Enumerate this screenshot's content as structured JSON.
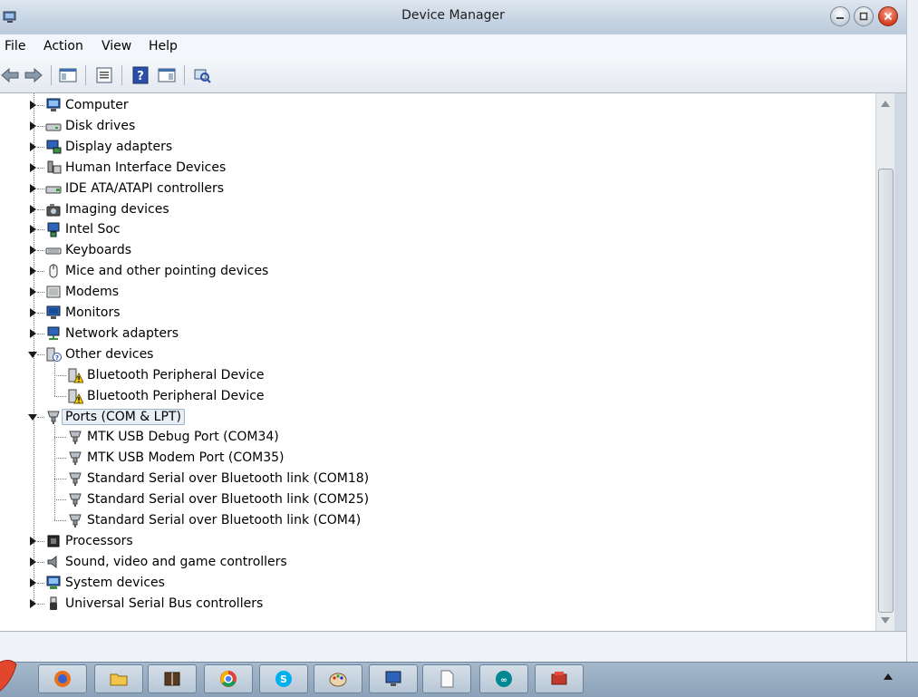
{
  "window": {
    "title": "Device Manager"
  },
  "menu": {
    "file": "File",
    "action": "Action",
    "view": "View",
    "help": "Help"
  },
  "toolbar": {
    "icons": [
      "back-arrow-icon",
      "forward-arrow-icon",
      "show-hide-console-tree-icon",
      "properties-icon",
      "help-icon",
      "show-action-pane-icon",
      "scan-hardware-icon"
    ]
  },
  "tree": {
    "items": [
      {
        "label": "Computer",
        "level": 0,
        "expanded": false,
        "icon": "computer-icon"
      },
      {
        "label": "Disk drives",
        "level": 0,
        "expanded": false,
        "icon": "disk-drive-icon"
      },
      {
        "label": "Display adapters",
        "level": 0,
        "expanded": false,
        "icon": "display-adapter-icon"
      },
      {
        "label": "Human Interface Devices",
        "level": 0,
        "expanded": false,
        "icon": "hid-icon"
      },
      {
        "label": "IDE ATA/ATAPI controllers",
        "level": 0,
        "expanded": false,
        "icon": "ide-controller-icon"
      },
      {
        "label": "Imaging devices",
        "level": 0,
        "expanded": false,
        "icon": "camera-icon"
      },
      {
        "label": "Intel Soc",
        "level": 0,
        "expanded": false,
        "icon": "network-device-icon"
      },
      {
        "label": "Keyboards",
        "level": 0,
        "expanded": false,
        "icon": "keyboard-icon"
      },
      {
        "label": "Mice and other pointing devices",
        "level": 0,
        "expanded": false,
        "icon": "mouse-icon"
      },
      {
        "label": "Modems",
        "level": 0,
        "expanded": false,
        "icon": "modem-icon"
      },
      {
        "label": "Monitors",
        "level": 0,
        "expanded": false,
        "icon": "monitor-icon"
      },
      {
        "label": "Network adapters",
        "level": 0,
        "expanded": false,
        "icon": "network-adapter-icon"
      },
      {
        "label": "Other devices",
        "level": 0,
        "expanded": true,
        "icon": "unknown-device-icon"
      },
      {
        "label": "Bluetooth Peripheral Device",
        "level": 1,
        "icon": "warning-device-icon"
      },
      {
        "label": "Bluetooth Peripheral Device",
        "level": 1,
        "icon": "warning-device-icon"
      },
      {
        "label": "Ports (COM & LPT)",
        "level": 0,
        "expanded": true,
        "selected": true,
        "icon": "port-icon"
      },
      {
        "label": "MTK USB Debug Port (COM34)",
        "level": 1,
        "icon": "port-icon"
      },
      {
        "label": "MTK USB Modem Port (COM35)",
        "level": 1,
        "icon": "port-icon"
      },
      {
        "label": "Standard Serial over Bluetooth link (COM18)",
        "level": 1,
        "icon": "port-icon"
      },
      {
        "label": "Standard Serial over Bluetooth link (COM25)",
        "level": 1,
        "icon": "port-icon"
      },
      {
        "label": "Standard Serial over Bluetooth link (COM4)",
        "level": 1,
        "icon": "port-icon"
      },
      {
        "label": "Processors",
        "level": 0,
        "expanded": false,
        "icon": "processor-icon"
      },
      {
        "label": "Sound, video and game controllers",
        "level": 0,
        "expanded": false,
        "icon": "speaker-icon"
      },
      {
        "label": "System devices",
        "level": 0,
        "expanded": false,
        "icon": "system-device-icon"
      },
      {
        "label": "Universal Serial Bus controllers",
        "level": 0,
        "expanded": false,
        "icon": "usb-icon"
      }
    ]
  },
  "taskbar": {
    "buttons": [
      "firefox-icon",
      "file-explorer-icon",
      "book-reader-icon",
      "chrome-icon",
      "skype-icon",
      "paint-icon",
      "remote-desktop-icon",
      "blank-document-icon",
      "arduino-icon",
      "device-manager-icon"
    ]
  }
}
